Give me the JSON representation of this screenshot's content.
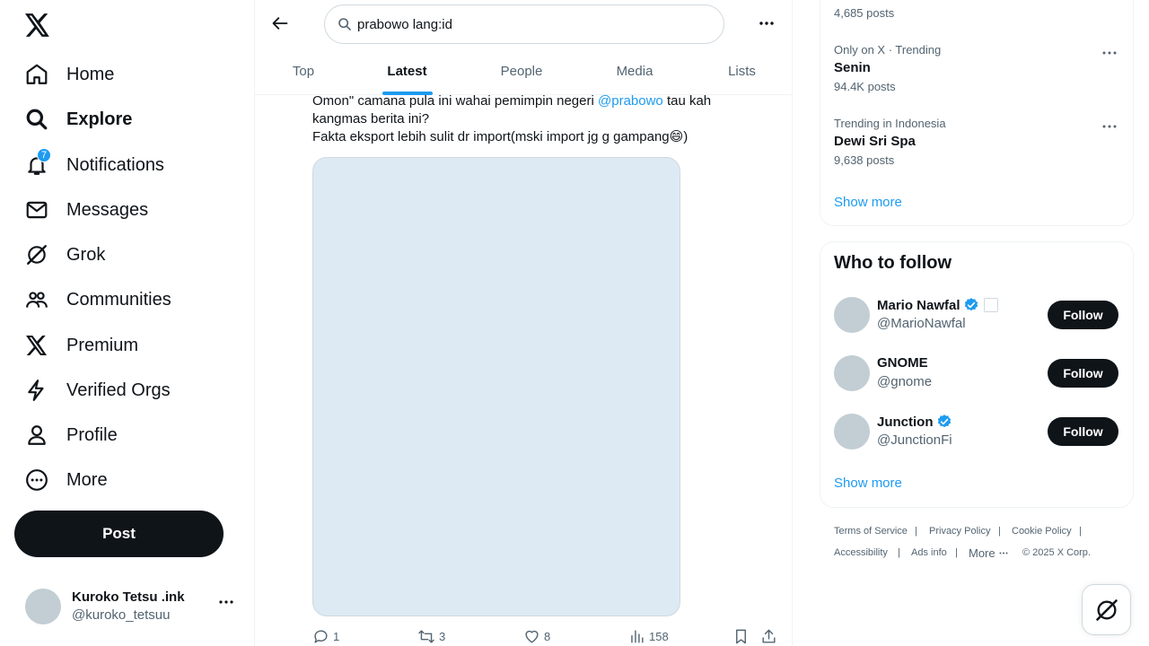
{
  "nav": {
    "items": [
      {
        "label": "Home",
        "icon": "home-icon"
      },
      {
        "label": "Explore",
        "icon": "search-icon"
      },
      {
        "label": "Notifications",
        "icon": "bell-icon",
        "badge": "7"
      },
      {
        "label": "Messages",
        "icon": "envelope-icon"
      },
      {
        "label": "Grok",
        "icon": "grok-icon"
      },
      {
        "label": "Communities",
        "icon": "people-icon"
      },
      {
        "label": "Premium",
        "icon": "x-logo-icon"
      },
      {
        "label": "Verified Orgs",
        "icon": "lightning-icon"
      },
      {
        "label": "Profile",
        "icon": "person-icon"
      },
      {
        "label": "More",
        "icon": "more-circle-icon"
      }
    ],
    "active": "Explore",
    "post_label": "Post"
  },
  "account": {
    "name": "Kuroko Tetsu .ink",
    "handle": "@kuroko_tetsuu"
  },
  "search": {
    "value": "prabowo lang:id"
  },
  "tabs": [
    {
      "label": "Top"
    },
    {
      "label": "Latest"
    },
    {
      "label": "People"
    },
    {
      "label": "Media"
    },
    {
      "label": "Lists"
    }
  ],
  "active_tab": "Latest",
  "tweet": {
    "line1_before": "Omon\" camana pula ini wahai pemimpin negeri ",
    "mention": "@prabowo",
    "line1_after": " tau kah kangmas berita ini?",
    "line2": "Fakta eksport lebih sulit dr import(mski import jg g gampang😄)",
    "replies": "1",
    "reposts": "3",
    "likes": "8",
    "views": "158"
  },
  "trends": {
    "partial_count": "4,685 posts",
    "items": [
      {
        "meta": "Only on X · Trending",
        "name": "Senin",
        "count": "94.4K posts"
      },
      {
        "meta": "Trending in Indonesia",
        "name": "Dewi Sri Spa",
        "count": "9,638 posts"
      }
    ],
    "show_more": "Show more"
  },
  "who_to_follow": {
    "title": "Who to follow",
    "users": [
      {
        "name": "Mario Nawfal",
        "handle": "@MarioNawfal",
        "verified": true,
        "affiliate": true
      },
      {
        "name": "GNOME",
        "handle": "@gnome",
        "verified": false
      },
      {
        "name": "Junction",
        "handle": "@JunctionFi",
        "verified": true
      }
    ],
    "follow_label": "Follow",
    "show_more": "Show more"
  },
  "footer": {
    "links": [
      "Terms of Service",
      "Privacy Policy",
      "Cookie Policy",
      "Accessibility",
      "Ads info"
    ],
    "more": "More",
    "copyright": "© 2025 X Corp."
  },
  "colors": {
    "accent": "#1d9bf0",
    "text": "#0f1419",
    "secondary": "#536471",
    "media_placeholder": "#ddeaf3"
  }
}
